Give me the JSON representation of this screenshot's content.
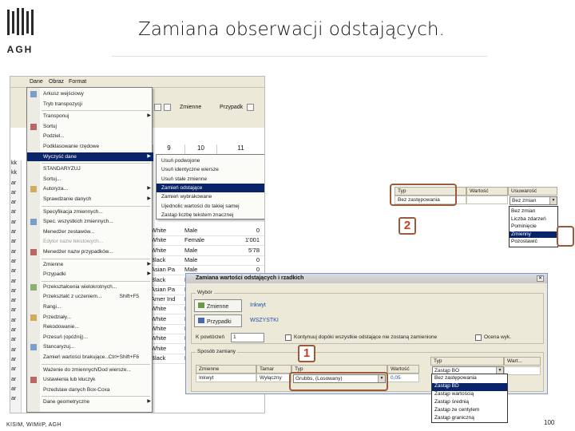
{
  "slide": {
    "title": "Zamiana obserwacji odstających.",
    "logo_text": "AGH",
    "footer_left": "KISIM, WIMiIP, AGH",
    "page_number": "100",
    "accent_color": "#9b5a3a",
    "callout_color": "#d43a1a"
  },
  "callouts": {
    "one": "1",
    "two": "2"
  },
  "screen1": {
    "menubar": [
      "Dane",
      "Obraz",
      "Format"
    ],
    "toolbar_labels": {
      "zmienne": "Zmienne",
      "przypadki": "Przypadk"
    },
    "col_headers": [
      "9",
      "10",
      "11"
    ],
    "row_stub": [
      "kk",
      "kk",
      "ar",
      "ar",
      "ar",
      "ar",
      "ar",
      "ar",
      "ar",
      "ar",
      "ar",
      "ar",
      "ar",
      "ar",
      "ar",
      "ar",
      "ar",
      "ar",
      "ar",
      "ar",
      "ar",
      "ar",
      "ar",
      "ar",
      "ar"
    ],
    "menu_items": [
      {
        "label": "Arkusz wejściowy",
        "icon": "check-icon"
      },
      {
        "label": "Tryb transpozycji"
      },
      {
        "label": "Transponuj",
        "arrow": true
      },
      {
        "label": "Sortuj"
      },
      {
        "label": "Podziel..."
      },
      {
        "label": "Podklasowanie rzędowe"
      },
      {
        "label": "Wyczyść dane",
        "arrow": true,
        "highlight": true
      },
      {
        "label": "STANDARYZUJ"
      },
      {
        "label": "Sortuj..."
      },
      {
        "label": "Autoryza...",
        "arrow": true
      },
      {
        "label": "Sprawdzanie danych",
        "arrow": true
      },
      {
        "label": "Specyfikacja zmiennych..."
      },
      {
        "label": "Spec. wszystkich zmiennych..."
      },
      {
        "label": "Menedżer zestawów..."
      },
      {
        "label": "Edytor nazw tekstowych...",
        "disabled": true
      },
      {
        "label": "Menedżer nazw przypadków..."
      },
      {
        "label": "Zmienne",
        "arrow": true
      },
      {
        "label": "Przypadki",
        "arrow": true
      },
      {
        "label": "Przekształcenia wielokrotnych..."
      },
      {
        "label": "Przekształć z uczeniem...",
        "shortcut": "Shift+F5"
      },
      {
        "label": "Rangi..."
      },
      {
        "label": "Przedziały..."
      },
      {
        "label": "Rekodowanie..."
      },
      {
        "label": "Przesuń (opóźnij)..."
      },
      {
        "label": "Stancaryzuj..."
      },
      {
        "label": "Zamień wartości brakujące...",
        "shortcut": "Ctrl+Shift+F6"
      },
      {
        "label": "Ważenie do zmiennych/Dod wiersze..."
      },
      {
        "label": "Ustawienia lub kłuczyk"
      },
      {
        "label": "Przedstaw danych Box-Coxa"
      },
      {
        "label": "Dane geometryczne",
        "arrow": true
      }
    ],
    "submenu_items": [
      {
        "label": "Usuń podwojone"
      },
      {
        "label": "Usuń identyczne wiersze"
      },
      {
        "label": "Usuń stałe zmienne"
      },
      {
        "label": "Zamień odstające",
        "highlight": true
      },
      {
        "label": "Zamień wybrakowane"
      },
      {
        "label": "Ujednolic wartości do takiej samej"
      },
      {
        "label": "Zastąp liczbę tekstem znacznej"
      }
    ],
    "data_rows": [
      [
        "White",
        "Male",
        "0"
      ],
      [
        "White",
        "Female",
        "1'001"
      ],
      [
        "White",
        "Male",
        "5'78"
      ],
      [
        "Black",
        "Male",
        "0"
      ],
      [
        "Asian Pa",
        "Male",
        "0"
      ],
      [
        "Black",
        "Male",
        "0"
      ],
      [
        "Asian Pa",
        "Male",
        "0"
      ],
      [
        "Amer Ind",
        "Male",
        "0"
      ],
      [
        "White",
        "Male",
        "0"
      ],
      [
        "White",
        "Male",
        "0"
      ],
      [
        "White",
        "Male",
        "0"
      ],
      [
        "White",
        "Male",
        "0"
      ],
      [
        "White",
        "Male",
        "0"
      ],
      [
        "Black",
        "Male",
        "0"
      ]
    ]
  },
  "dialog": {
    "title": "Zamiana wartości odstających i rzadkich",
    "wybor_legend": "Wybór",
    "btn_zmienne": "Zmienne",
    "btn_przypadki": "Przypadki",
    "link_zmienne": "Inkwyt",
    "link_przypadki": "WSZYSTKI",
    "k_powtorzen_label": "K powtórzeń",
    "k_powtorzen_value": "1",
    "checkbox_text": "Kontynuuj dopóki wszystkie odstające nie zostaną zamienione",
    "checkbox2_text": "Ocena wyk.",
    "sposob_legend": "Sposób zamiany",
    "headers": [
      "Zmienne",
      "Tamar",
      "Typ",
      "Wartość"
    ],
    "row": [
      "Inkwyt",
      "Wyłączny",
      "Grubbs, (Losowany)",
      "0,05"
    ],
    "right_headers": [
      "Typ",
      "Wart..."
    ],
    "typ_combo": "Zastąp BO",
    "typ_options": [
      {
        "label": "Bez zastępowania"
      },
      {
        "label": "Zastąp BD",
        "highlight": true
      },
      {
        "label": "Zastąp wartością"
      },
      {
        "label": "Zastąp średnią"
      },
      {
        "label": "Zastąp ze centylem"
      },
      {
        "label": "Zastąp graniczną"
      }
    ]
  },
  "table3": {
    "headers": [
      "Typ",
      "Wartość",
      "Usuwarość"
    ],
    "row_typ": "Bez zastępowania",
    "combo": "Bez zmian",
    "options": [
      {
        "label": "Bez zmian"
      },
      {
        "label": "Liczba zdarzeń"
      },
      {
        "label": "Pominięcie"
      },
      {
        "label": "Zmienny",
        "highlight": true
      },
      {
        "label": "Pozostawić"
      }
    ]
  }
}
